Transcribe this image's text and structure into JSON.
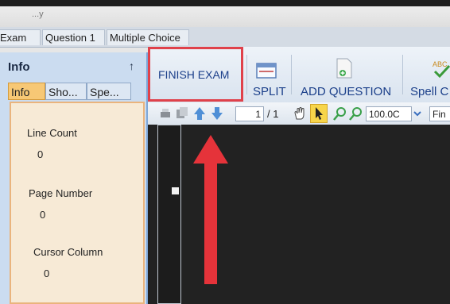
{
  "window": {
    "crumb": "...y",
    "tabs": [
      "Exam",
      "Question 1",
      "Multiple Choice"
    ]
  },
  "info_panel": {
    "title": "Info",
    "pin": "↑",
    "tabs": [
      {
        "label": "Info",
        "active": true
      },
      {
        "label": "Sho...",
        "active": false
      },
      {
        "label": "Spe...",
        "active": false
      }
    ],
    "fields": [
      {
        "label": "Line Count",
        "value": "0"
      },
      {
        "label": "Page Number",
        "value": "0"
      },
      {
        "label": "Cursor Column",
        "value": "0"
      }
    ]
  },
  "ribbon": {
    "finish_label": "FINISH EXAM",
    "split_label": "SPLIT",
    "add_question_label": "ADD QUESTION",
    "spell_label": "Spell C",
    "highlight_color": "#e0414a"
  },
  "toolbar": {
    "page_current": "1",
    "page_total": "/ 1",
    "zoom": "100.0C",
    "find_text": "Fin"
  },
  "annotation": {
    "arrow_color": "#e5333a"
  }
}
